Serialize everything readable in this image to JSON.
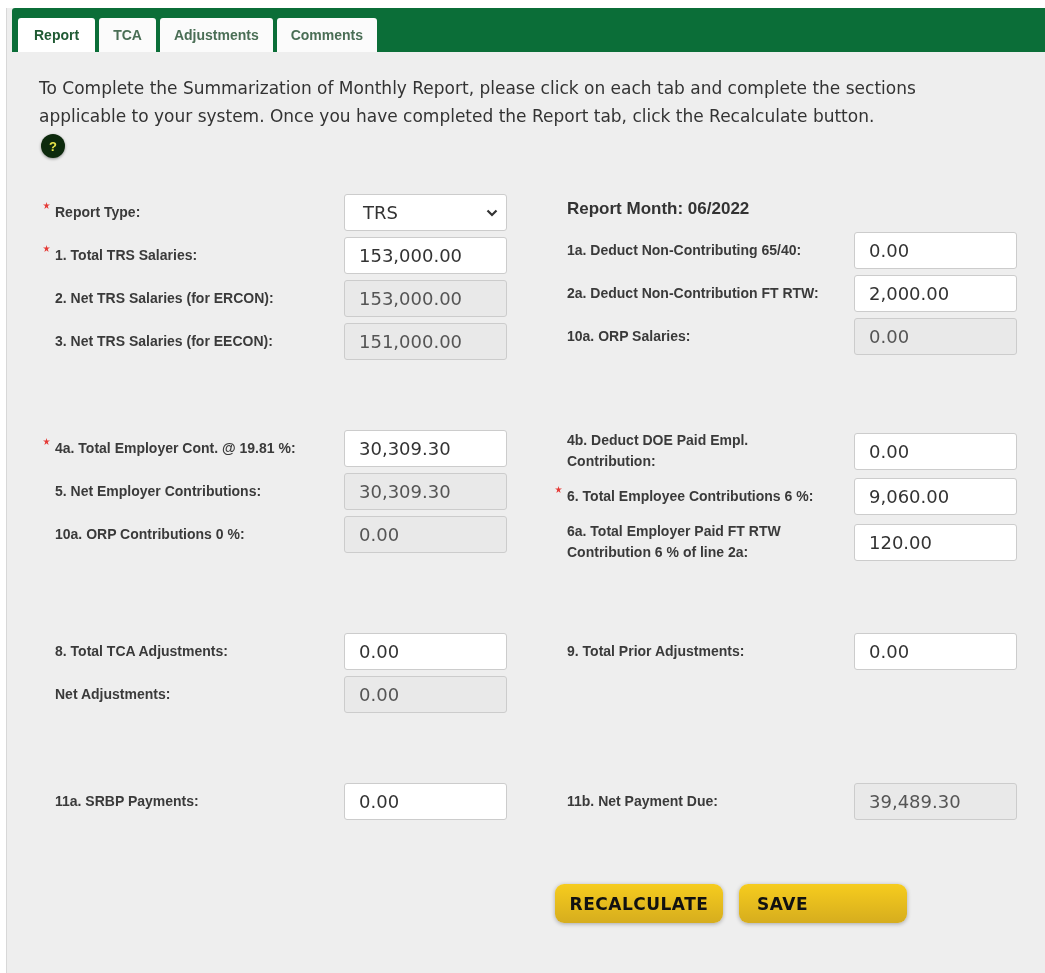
{
  "tabs": [
    {
      "label": "Report",
      "selected": true
    },
    {
      "label": "TCA",
      "selected": false
    },
    {
      "label": "Adjustments",
      "selected": false
    },
    {
      "label": "Comments",
      "selected": false
    }
  ],
  "intro": "To Complete the Summarization of Monthly Report, please click on each tab and complete the sections applicable to your system. Once you have completed the Report tab, click the Recalculate button.",
  "help": {
    "label": "?"
  },
  "sections": [
    {
      "left": [
        {
          "label": "Report Type:",
          "required": true,
          "kind": "select",
          "value": "TRS"
        },
        {
          "label": "1. Total TRS Salaries:",
          "required": true,
          "kind": "input",
          "value": "153,000.00"
        },
        {
          "label": "2. Net TRS Salaries (for ERCON):",
          "required": false,
          "kind": "readonly",
          "value": "153,000.00"
        },
        {
          "label": "3. Net TRS Salaries (for EECON):",
          "required": false,
          "kind": "readonly",
          "value": "151,000.00"
        }
      ],
      "heading": "Report Month: 06/2022",
      "right": [
        {
          "label": "1a. Deduct Non-Contributing 65/40:",
          "required": false,
          "kind": "input",
          "value": "0.00"
        },
        {
          "label": "2a. Deduct Non-Contribution FT RTW:",
          "required": false,
          "kind": "input",
          "value": "2,000.00"
        },
        {
          "label": "10a. ORP Salaries:",
          "required": false,
          "kind": "readonly",
          "value": "0.00"
        }
      ]
    },
    {
      "left": [
        {
          "label": "4a. Total Employer Cont. @ 19.81 %:",
          "required": true,
          "kind": "input",
          "value": "30,309.30"
        },
        {
          "label": "5. Net Employer Contributions:",
          "required": false,
          "kind": "readonly",
          "value": "30,309.30"
        },
        {
          "label": "10a. ORP Contributions 0 %:",
          "required": false,
          "kind": "readonly",
          "value": "0.00"
        }
      ],
      "right": [
        {
          "label": "4b. Deduct DOE Paid Empl. Contribution:",
          "required": false,
          "kind": "input",
          "value": "0.00"
        },
        {
          "label": "6. Total Employee Contributions 6 %:",
          "required": true,
          "kind": "input",
          "value": "9,060.00"
        },
        {
          "label": "6a. Total Employer Paid FT RTW Contribution 6 % of line 2a:",
          "required": false,
          "kind": "input",
          "value": "120.00"
        }
      ]
    },
    {
      "left": [
        {
          "label": "8. Total TCA Adjustments:",
          "required": false,
          "kind": "input",
          "value": "0.00"
        },
        {
          "label": "Net Adjustments:",
          "required": false,
          "kind": "readonly",
          "value": "0.00"
        }
      ],
      "right": [
        {
          "label": "9. Total Prior Adjustments:",
          "required": false,
          "kind": "input",
          "value": "0.00"
        }
      ]
    },
    {
      "left": [
        {
          "label": "11a. SRBP Payments:",
          "required": false,
          "kind": "input",
          "value": "0.00"
        }
      ],
      "right": [
        {
          "label": "11b. Net Payment Due:",
          "required": false,
          "kind": "readonly",
          "value": "39,489.30"
        }
      ]
    }
  ],
  "buttons": [
    {
      "label": "RECALCULATE",
      "kind": "recalculate"
    },
    {
      "label": "SAVE",
      "kind": "save"
    }
  ]
}
